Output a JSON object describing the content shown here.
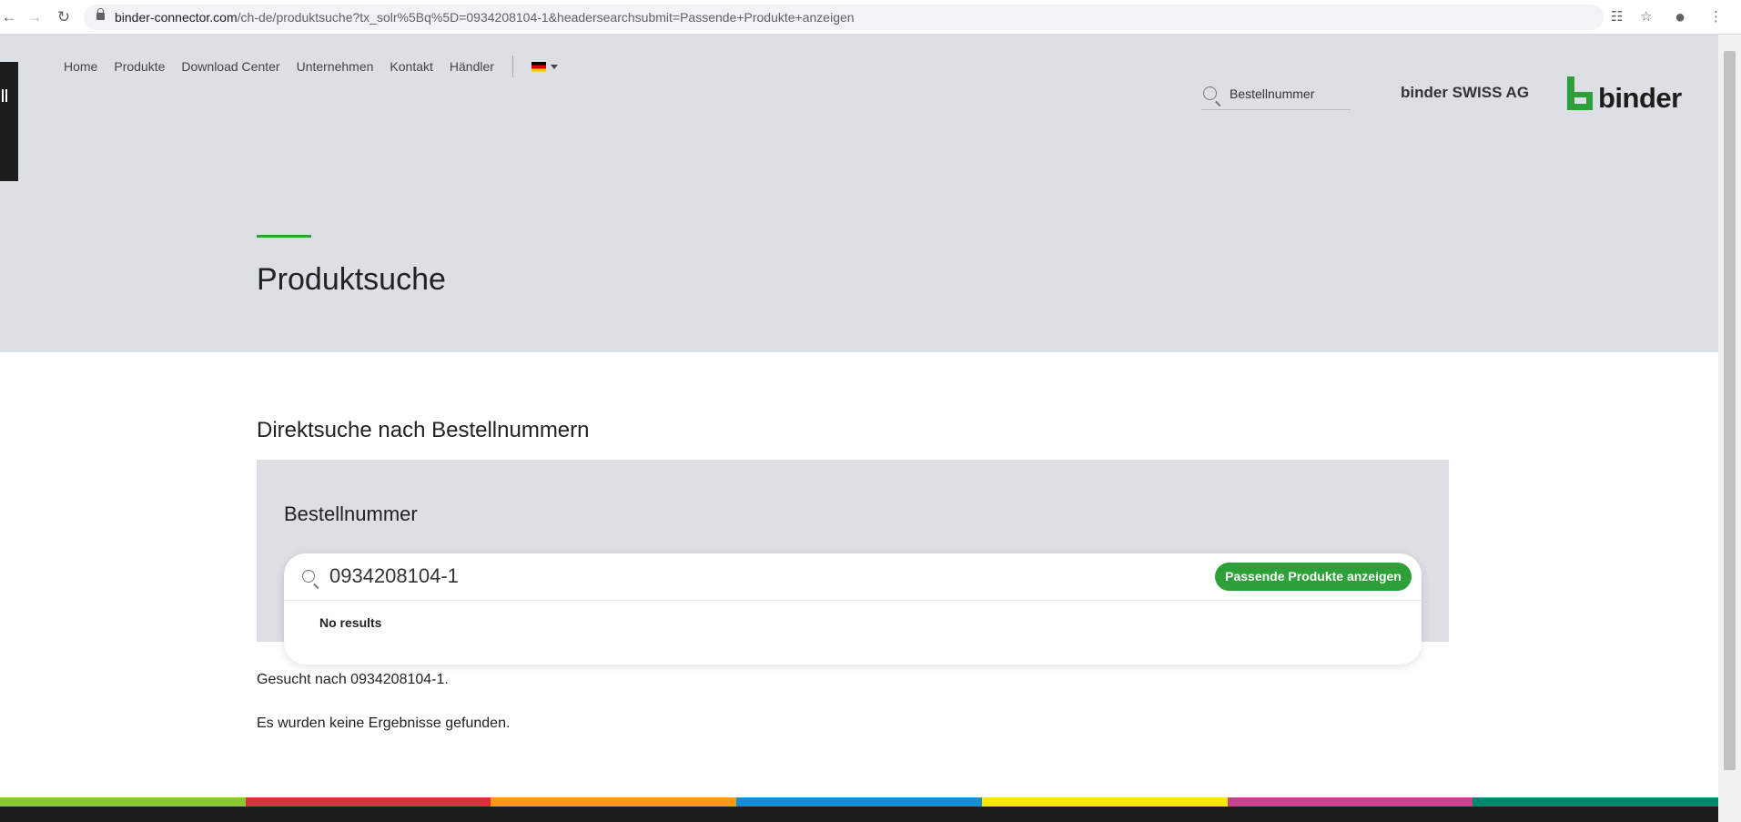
{
  "browser": {
    "url_host": "binder-connector.com",
    "url_path": "/ch-de/produktsuche?tx_solr%5Bq%5D=0934208104-1&headersearchsubmit=Passende+Produkte+anzeigen"
  },
  "header": {
    "nav": [
      "Home",
      "Produkte",
      "Download Center",
      "Unternehmen",
      "Kontakt",
      "Händler"
    ],
    "search_placeholder": "Bestellnummer",
    "company": "binder SWISS AG",
    "logo_text": "binder"
  },
  "hero": {
    "title": "Produktsuche"
  },
  "search_section": {
    "title": "Direktsuche nach Bestellnummern",
    "label": "Bestellnummer",
    "value": "0934208104-1",
    "button": "Passende Produkte anzeigen",
    "dropdown_message": "No results"
  },
  "results": {
    "searched_for": "Gesucht nach 0934208104-1.",
    "none_found": "Es wurden keine Ergebnisse gefunden."
  },
  "colors": {
    "brand_green": "#2ea03a",
    "band": [
      "#8cc63f",
      "#d7313d",
      "#f39c12",
      "#1b8ccc",
      "#f7e600",
      "#c4458e",
      "#00866e"
    ]
  }
}
